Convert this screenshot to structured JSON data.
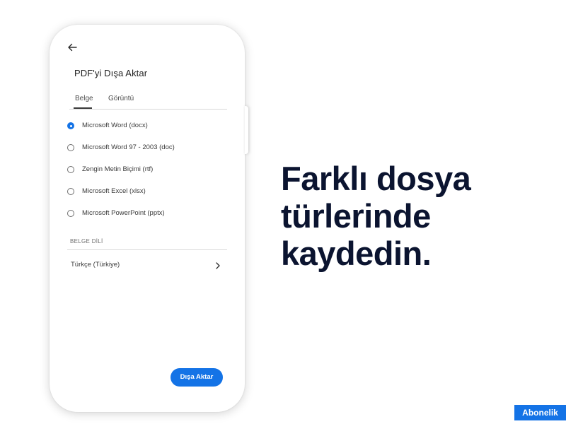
{
  "screen": {
    "title": "PDF'yi Dışa Aktar",
    "tabs": [
      {
        "label": "Belge",
        "active": true
      },
      {
        "label": "Görüntü",
        "active": false
      }
    ],
    "format_options": [
      {
        "label": "Microsoft Word (docx)",
        "selected": true
      },
      {
        "label": "Microsoft Word 97 - 2003 (doc)",
        "selected": false
      },
      {
        "label": "Zengin Metin Biçimi (rtf)",
        "selected": false
      },
      {
        "label": "Microsoft Excel (xlsx)",
        "selected": false
      },
      {
        "label": "Microsoft PowerPoint (pptx)",
        "selected": false
      }
    ],
    "section_label": "BELGE DİLİ",
    "language_value": "Türkçe (Türkiye)",
    "export_button_label": "Dışa Aktar",
    "icons": {
      "back": "back-arrow-icon",
      "chevron": "chevron-right-icon"
    }
  },
  "headline": {
    "lines": [
      "Farklı dosya",
      "türlerinde",
      "kaydedin."
    ]
  },
  "badge": {
    "label": "Abonelik"
  },
  "colors": {
    "accent": "#1473e6",
    "headline": "#0b1430",
    "background": "#ffffff"
  }
}
